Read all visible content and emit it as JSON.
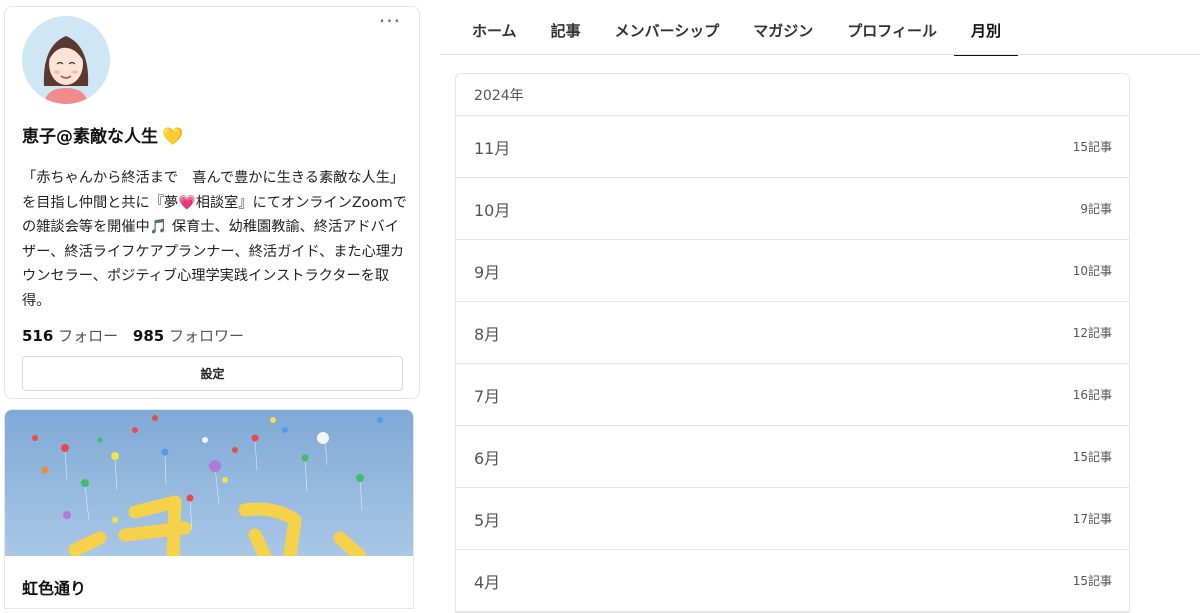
{
  "profile": {
    "name": "恵子@素敵な人生",
    "name_emoji": "💛",
    "bio_part1": "「赤ちゃんから終活まで　喜んで豊かに生きる素敵な人生」を目指し仲間と共に『夢",
    "bio_heart": "💗",
    "bio_part2": "相談室』にてオンラインZoomでの雑談会等を開催中",
    "bio_note": "🎵",
    "bio_part3": " 保育士、幼稚園教諭、終活アドバイザー、終活ライフケアプランナー、終活ガイド、また心理カウンセラー、ポジティブ心理学実践インストラクターを取得。",
    "follow_count": "516",
    "follow_label": "フォロー",
    "follower_count": "985",
    "follower_label": "フォロワー",
    "settings_label": "設定",
    "more_label": "···"
  },
  "magazine": {
    "title": "虹色通り"
  },
  "tabs": [
    {
      "label": "ホーム"
    },
    {
      "label": "記事"
    },
    {
      "label": "メンバーシップ"
    },
    {
      "label": "マガジン"
    },
    {
      "label": "プロフィール"
    },
    {
      "label": "月別"
    }
  ],
  "archive": {
    "year": "2024年",
    "months": [
      {
        "month": "11月",
        "count": "15記事"
      },
      {
        "month": "10月",
        "count": "9記事"
      },
      {
        "month": "9月",
        "count": "10記事"
      },
      {
        "month": "8月",
        "count": "12記事"
      },
      {
        "month": "7月",
        "count": "16記事"
      },
      {
        "month": "6月",
        "count": "15記事"
      },
      {
        "month": "5月",
        "count": "17記事"
      },
      {
        "month": "4月",
        "count": "15記事"
      }
    ]
  },
  "colors": {
    "accent_heart": "#f2c12e",
    "pink_heart": "#ff4f91",
    "sky": "#8cb4dc",
    "title_yellow": "#f6d24a"
  }
}
